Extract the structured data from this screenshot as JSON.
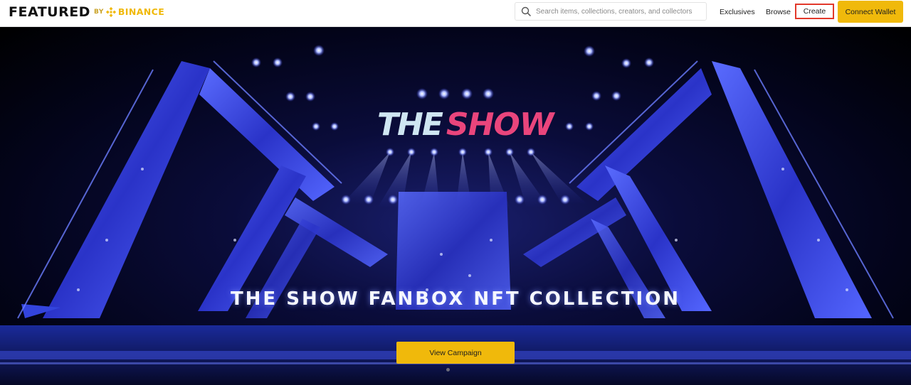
{
  "brand": {
    "featured": "FEATURED",
    "by": "BY",
    "binance": "BINANCE",
    "logo_icon": "binance-diamond-icon",
    "accent_color": "#f0b90b"
  },
  "search": {
    "placeholder": "Search items, collections, creators, and collectors",
    "value": "",
    "icon": "search-icon"
  },
  "nav": {
    "exclusives": "Exclusives",
    "browse": "Browse",
    "create": "Create",
    "connect_wallet": "Connect Wallet"
  },
  "hero": {
    "logo_the": "THE",
    "logo_show": "SHOW",
    "title": "THE SHOW FANBOX NFT COLLECTION",
    "cta": "View Campaign",
    "carousel_dot_active": 1
  },
  "colors": {
    "button": "#f0b90b",
    "highlight_box": "#e2392b",
    "logo_pink": "#e9457c",
    "stage_blue": "#2b35d8"
  }
}
